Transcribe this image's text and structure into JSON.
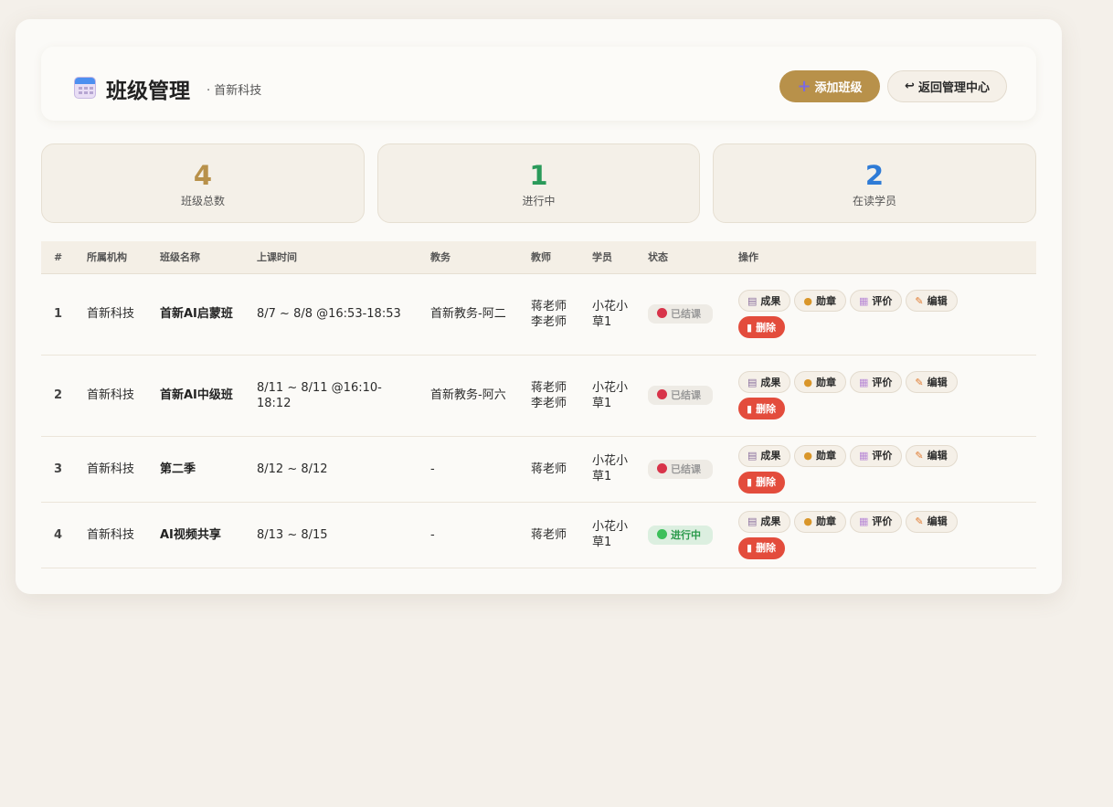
{
  "header": {
    "title": "班级管理",
    "subtitle": "· 首新科技",
    "add_button": "添加班级",
    "back_button": "返回管理中心"
  },
  "stats": [
    {
      "value": "4",
      "label": "班级总数",
      "color": "#b8914a"
    },
    {
      "value": "1",
      "label": "进行中",
      "color": "#2a9a5a"
    },
    {
      "value": "2",
      "label": "在读学员",
      "color": "#2e7bd6"
    }
  ],
  "table": {
    "columns": [
      "#",
      "所属机构",
      "班级名称",
      "上课时间",
      "教务",
      "教师",
      "学员",
      "状态",
      "操作"
    ],
    "rows": [
      {
        "idx": "1",
        "org": "首新科技",
        "name": "首新AI启蒙班",
        "time": "8/7 ~ 8/8 @16:53-18:53",
        "admin": "首新教务-阿二",
        "teacher": "蒋老师\n李老师",
        "students": "小花小草1",
        "status": "已结课"
      },
      {
        "idx": "2",
        "org": "首新科技",
        "name": "首新AI中级班",
        "time": "8/11 ~ 8/11 @16:10-18:12",
        "admin": "首新教务-阿六",
        "teacher": "蒋老师\n李老师",
        "students": "小花小草1",
        "status": "已结课"
      },
      {
        "idx": "3",
        "org": "首新科技",
        "name": "第二季",
        "time": "8/12 ~ 8/12",
        "admin": "-",
        "teacher": "蒋老师",
        "students": "小花小草1",
        "status": "已结课"
      },
      {
        "idx": "4",
        "org": "首新科技",
        "name": "AI视频共享",
        "time": "8/13 ~ 8/15",
        "admin": "-",
        "teacher": "蒋老师",
        "students": "小花小草1",
        "status": "进行中"
      }
    ]
  },
  "actions": {
    "result": "成果",
    "medal": "勋章",
    "evaluate": "评价",
    "edit": "编辑",
    "delete": "删除"
  },
  "icons": [
    "calendar-icon",
    "plus-icon",
    "return-icon",
    "clipboard-icon",
    "medal-icon",
    "memo-icon",
    "pencil-icon",
    "trash-icon",
    "status-dot-icon"
  ]
}
